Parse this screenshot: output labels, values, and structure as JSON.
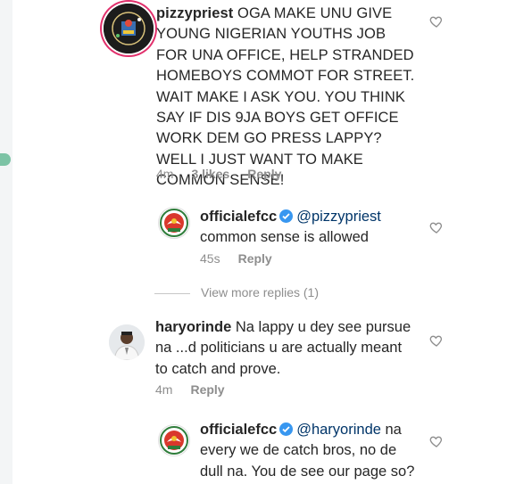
{
  "comments": [
    {
      "username": "pizzypriest",
      "text": " OGA MAKE UNU GIVE\nYOUNG NIGERIAN YOUTHS JOB\nFOR UNA OFFICE, HELP STRANDED\nHOMEBOYS COMMOT FOR STREET.\nWAIT MAKE I ASK YOU. YOU THINK\nSAY IF DIS 9JA BOYS GET OFFICE\nWORK DEM GO PRESS LAPPY?\nWELL I JUST WANT TO MAKE\nCOMMON SENSE!",
      "time": "4m",
      "likes": "3 likes",
      "reply": "Reply"
    },
    {
      "username": "officialefcc",
      "mention": "@pizzypriest",
      "text": "common sense is allowed",
      "time": "45s",
      "reply": "Reply"
    },
    {
      "username": "haryorinde",
      "text": " Na lappy u dey see pursue\nna ...d politicians u are actually meant\nto catch and prove.",
      "time": "4m",
      "reply": "Reply"
    },
    {
      "username": "officialefcc",
      "mention": "@haryorinde",
      "text": " na\nevery we de catch bros, no de\ndull na. You de see our page so?"
    }
  ],
  "view_more": "View more replies (1)",
  "icons": {
    "heart": "heart-outline-icon",
    "verified": "verified-badge-icon"
  },
  "colors": {
    "verified": "#3897f0",
    "mention": "#003569",
    "meta": "#8e8e8e"
  }
}
